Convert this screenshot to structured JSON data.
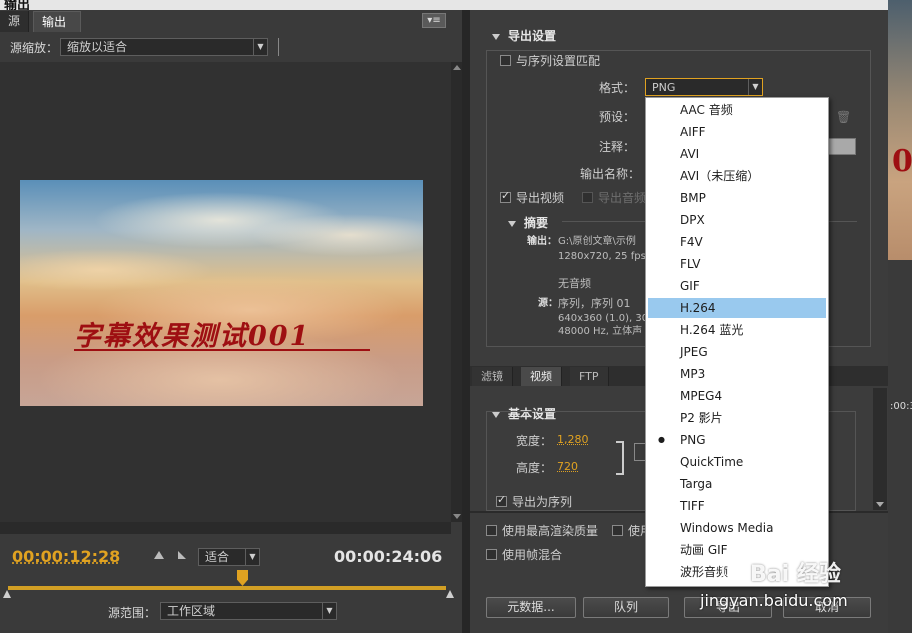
{
  "window": {
    "title": "输出"
  },
  "left": {
    "tabs": [
      "源",
      "输出"
    ],
    "scale_label": "源缩放：",
    "scale_value": "缩放以适合",
    "video_caption": "字幕效果测试001",
    "timecode_current": "00:00:12:28",
    "fit_value": "适合",
    "timecode_duration": "00:00:24:06",
    "range_label": "源范围：",
    "range_value": "工作区域"
  },
  "export": {
    "title": "导出设置",
    "match_sequence": "与序列设置匹配",
    "format_label": "格式：",
    "format_value": "PNG",
    "preset_label": "预设：",
    "comment_label": "注释：",
    "output_name_label": "输出名称：",
    "export_video": "导出视频",
    "export_audio": "导出音频",
    "summary_title": "摘要",
    "output_label": "输出：",
    "output_path": "G:\\原创文章\\示例",
    "output_spec": "1280x720, 25 fps",
    "no_audio": "无音频",
    "source_label": "源：",
    "source_seq": "序列，序列 01",
    "source_spec1": "640x360 (1.0), 30",
    "source_spec2": "48000 Hz, 立体声"
  },
  "tabs2": [
    "滤镜",
    "视频",
    "FTP"
  ],
  "basic": {
    "title": "基本设置",
    "width_label": "宽度：",
    "width_value": "1,280",
    "height_label": "高度：",
    "height_value": "720",
    "export_as_sequence": "导出为序列"
  },
  "options": {
    "max_render": "使用最高渲染质量",
    "use_partial": "使用",
    "frame_blend": "使用帧混合"
  },
  "buttons": {
    "metadata": "元数据...",
    "queue": "队列",
    "export": "导出",
    "cancel": "取消"
  },
  "format_options": [
    "AAC 音频",
    "AIFF",
    "AVI",
    "AVI（未压缩）",
    "BMP",
    "DPX",
    "F4V",
    "FLV",
    "GIF",
    "H.264",
    "H.264 蓝光",
    "JPEG",
    "MP3",
    "MPEG4",
    "P2 影片",
    "PNG",
    "QuickTime",
    "Targa",
    "TIFF",
    "Windows Media",
    "动画 GIF",
    "波形音频"
  ],
  "format_highlighted": "H.264",
  "format_selected": "PNG",
  "right_strip": {
    "timecode": ":00:3"
  },
  "watermark": {
    "logo": "Bai 经验",
    "url": "jingyan.baidu.com"
  },
  "colors": {
    "accent": "#e0a221",
    "highlight": "#99c9ee",
    "caption": "#9e0f12"
  }
}
